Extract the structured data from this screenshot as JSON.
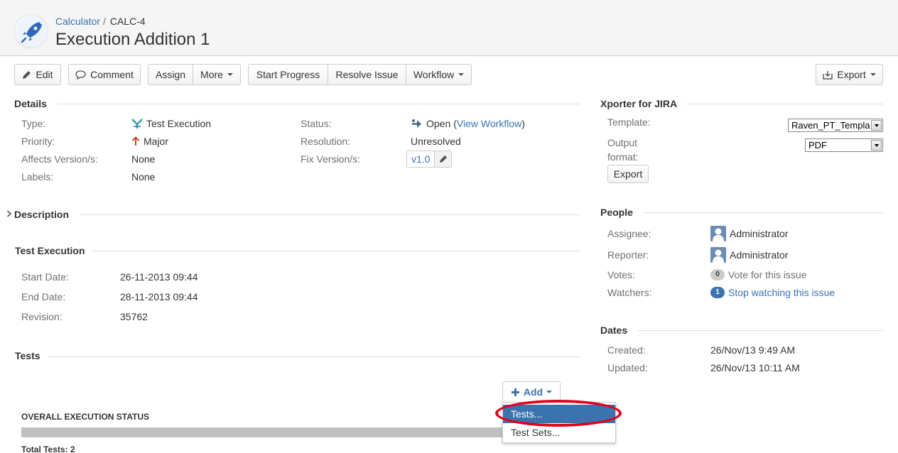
{
  "header": {
    "breadcrumb_project": "Calculator",
    "breadcrumb_sep": "/",
    "issue_key": "CALC-4",
    "title": "Execution Addition 1"
  },
  "toolbar": {
    "edit": "Edit",
    "comment": "Comment",
    "assign": "Assign",
    "more": "More",
    "start_progress": "Start Progress",
    "resolve_issue": "Resolve Issue",
    "workflow": "Workflow",
    "export": "Export"
  },
  "details": {
    "heading": "Details",
    "type_label": "Type:",
    "type_value": "Test Execution",
    "priority_label": "Priority:",
    "priority_value": "Major",
    "affects_label": "Affects Version/s:",
    "affects_value": "None",
    "labels_label": "Labels:",
    "labels_value": "None",
    "status_label": "Status:",
    "status_value": "Open",
    "view_workflow": "View Workflow",
    "resolution_label": "Resolution:",
    "resolution_value": "Unresolved",
    "fix_label": "Fix Version/s:",
    "fix_value": "v1.0"
  },
  "description": {
    "heading": "Description"
  },
  "test_execution": {
    "heading": "Test Execution",
    "start_label": "Start Date:",
    "start_value": "26-11-2013 09:44",
    "end_label": "End Date:",
    "end_value": "28-11-2013 09:44",
    "revision_label": "Revision:",
    "revision_value": "35762"
  },
  "tests": {
    "heading": "Tests",
    "add_label": "Add",
    "menu_tests": "Tests...",
    "menu_test_sets": "Test Sets...",
    "overall_status": "OVERALL EXECUTION STATUS",
    "total_tests": "Total Tests: 2"
  },
  "xporter": {
    "heading": "Xporter for JIRA",
    "template_label": "Template:",
    "template_value": "Raven_PT_Templa",
    "output_label_1": "Output",
    "output_label_2": "format:",
    "output_value": "PDF",
    "export_button": "Export"
  },
  "people": {
    "heading": "People",
    "assignee_label": "Assignee:",
    "assignee_value": "Administrator",
    "reporter_label": "Reporter:",
    "reporter_value": "Administrator",
    "votes_label": "Votes:",
    "votes_count": "0",
    "votes_link": "Vote for this issue",
    "watchers_label": "Watchers:",
    "watchers_count": "1",
    "watchers_link": "Stop watching this issue"
  },
  "dates": {
    "heading": "Dates",
    "created_label": "Created:",
    "created_value": "26/Nov/13 9:49 AM",
    "updated_label": "Updated:",
    "updated_value": "26/Nov/13 10:11 AM"
  },
  "colors": {
    "link": "#3b73af",
    "highlight_ring": "#e3001b",
    "priority_arrow": "#cc4125"
  }
}
